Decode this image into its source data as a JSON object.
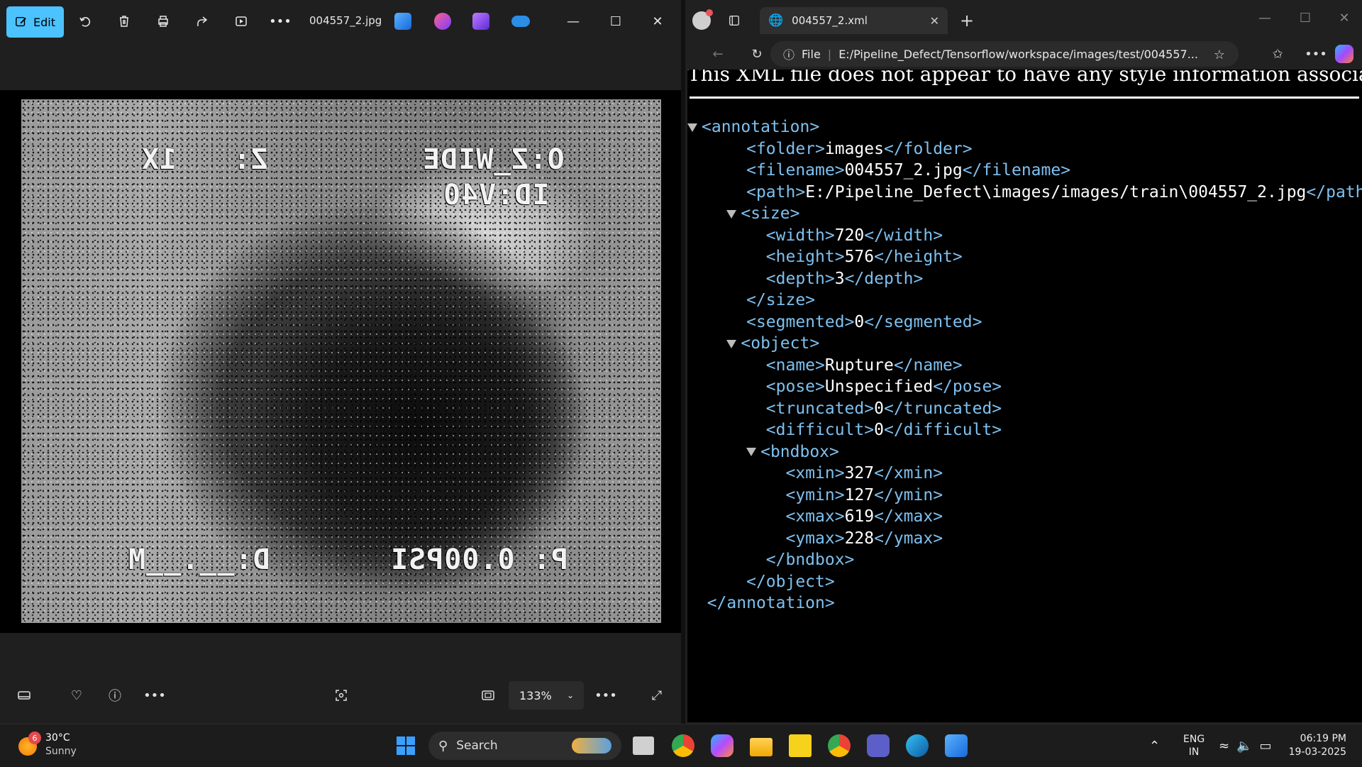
{
  "photos": {
    "edit_label": "Edit",
    "filename": "004557_2.jpg",
    "zoom": "133%",
    "osd": {
      "top_left": "1X",
      "top_mid": "Z:",
      "top_right": "O:Z_WIDE",
      "id": "ID:V40",
      "bottom_left": "D:__.__M",
      "bottom_right": "P: 0.00PSI"
    }
  },
  "browser": {
    "tab_title": "004557_2.xml",
    "address_scheme": "File",
    "address": "E:/Pipeline_Defect/Tensorflow/workspace/images/test/004557...",
    "style_note": "This XML file does not appear to have any style information associated w",
    "xml": {
      "annotation_open": "<annotation>",
      "annotation_close": "</annotation>",
      "folder": "images",
      "filename": "004557_2.jpg",
      "path": "E:/Pipeline_Defect\\images/images/train\\004557_2.jpg",
      "size": {
        "width": "720",
        "height": "576",
        "depth": "3"
      },
      "segmented": "0",
      "object": {
        "name": "Rupture",
        "pose": "Unspecified",
        "truncated": "0",
        "difficult": "0",
        "bndbox": {
          "xmin": "327",
          "ymin": "127",
          "xmax": "619",
          "ymax": "228"
        }
      }
    }
  },
  "taskbar": {
    "weather_temp": "30°C",
    "weather_desc": "Sunny",
    "weather_badge": "6",
    "search_label": "Search",
    "lang_1": "ENG",
    "lang_2": "IN",
    "time": "06:19 PM",
    "date": "19-03-2025"
  }
}
